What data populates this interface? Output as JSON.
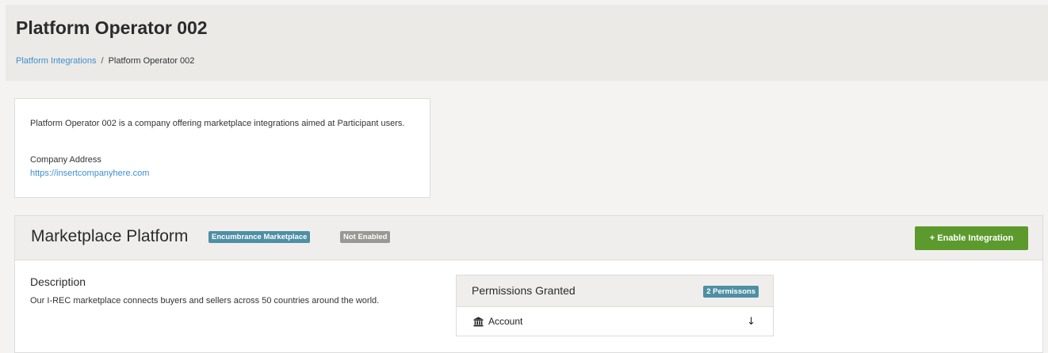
{
  "header": {
    "title": "Platform Operator 002",
    "breadcrumb": {
      "link": "Platform Integrations",
      "separator": "/",
      "current": "Platform Operator 002"
    }
  },
  "company": {
    "description": "Platform Operator 002 is a company offering marketplace integrations aimed at Participant users.",
    "address_label": "Company Address",
    "address_url": "https://insertcompanyhere.com"
  },
  "platform": {
    "title": "Marketplace Platform",
    "type_badge": "Encumbrance Marketplace",
    "status_badge": "Not Enabled",
    "enable_button": "+ Enable Integration",
    "description_heading": "Description",
    "description_text": "Our I-REC marketplace connects buyers and sellers across 50 countries around the world.",
    "permissions": {
      "title": "Permissions Granted",
      "count_badge": "2 Permissons",
      "items": [
        {
          "label": "Account",
          "icon": "bank-icon",
          "toggle_icon": "arrow-down-icon"
        }
      ]
    }
  },
  "colors": {
    "link": "#3d8fd0",
    "badge_teal": "#4e8fa4",
    "badge_gray": "#9a9894",
    "button_green": "#5c9a2d"
  }
}
